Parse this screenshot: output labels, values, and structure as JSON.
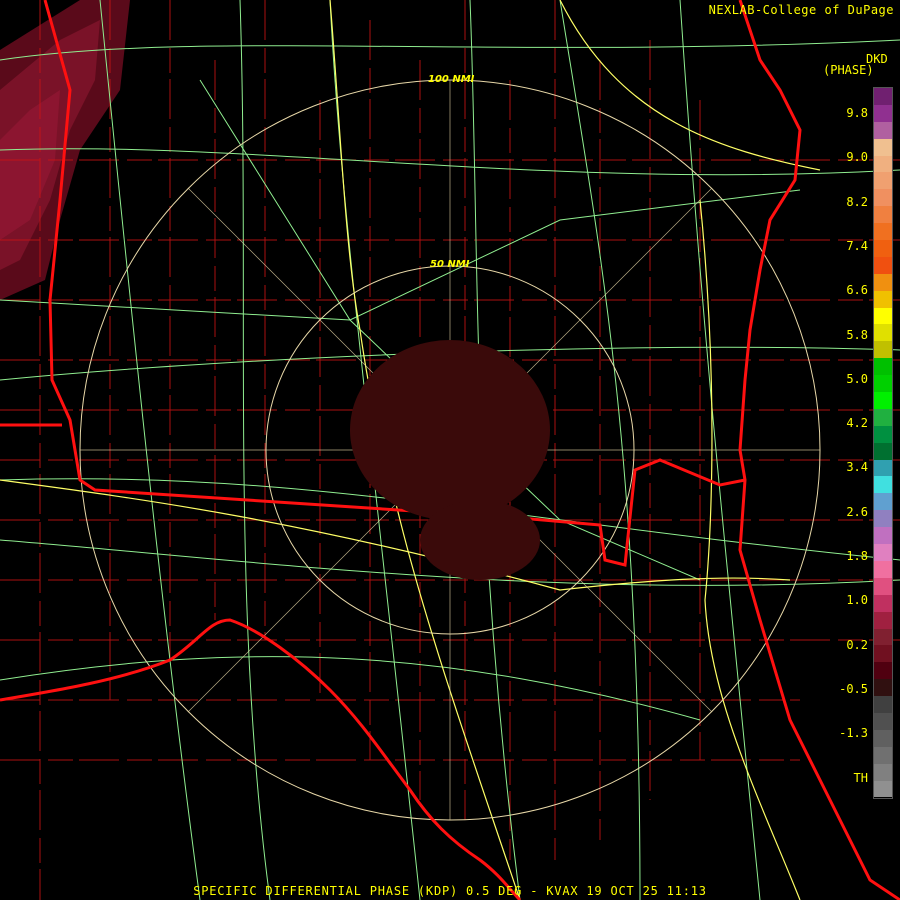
{
  "credit": "NEXLAB-College of DuPage",
  "units": {
    "line1": "DKD",
    "line2": "(PHASE)"
  },
  "rings": {
    "inner": "50 NMI",
    "outer": "100 NMI"
  },
  "caption": "SPECIFIC DIFFERENTIAL PHASE (KDP) 0.5 DEG - KVAX 19 OCT 25 11:13",
  "scale": {
    "ticks": [
      "9.8",
      "9.0",
      "8.2",
      "7.4",
      "6.6",
      "5.8",
      "5.0",
      "4.2",
      "3.4",
      "2.6",
      "1.8",
      "1.0",
      "0.2",
      "-0.5",
      "-1.3",
      "TH"
    ],
    "colors": [
      "#702070",
      "#903090",
      "#b060a0",
      "#f0c090",
      "#f0b080",
      "#f0a070",
      "#f09060",
      "#f08040",
      "#f07020",
      "#f06010",
      "#f05010",
      "#f09010",
      "#f0c000",
      "#ffff00",
      "#e0e000",
      "#c0c000",
      "#00c000",
      "#00d000",
      "#00f000",
      "#20b040",
      "#009040",
      "#007030",
      "#30a0b0",
      "#40e0e0",
      "#60a0d0",
      "#9080c0",
      "#c070c0",
      "#e080c0",
      "#f070a0",
      "#e05080",
      "#c03060",
      "#a02040",
      "#802030",
      "#701020",
      "#500010",
      "#301010",
      "#404040",
      "#505050",
      "#606060",
      "#707070",
      "#808080",
      "#909090"
    ],
    "colors_note": "colors_only"
  },
  "colors": {
    "state_border": "#ff1010",
    "county": "#c81414",
    "highway": "#90ee90",
    "interstate": "#ffff66",
    "ring": "#e8d8a8",
    "label": "#ffff00"
  }
}
